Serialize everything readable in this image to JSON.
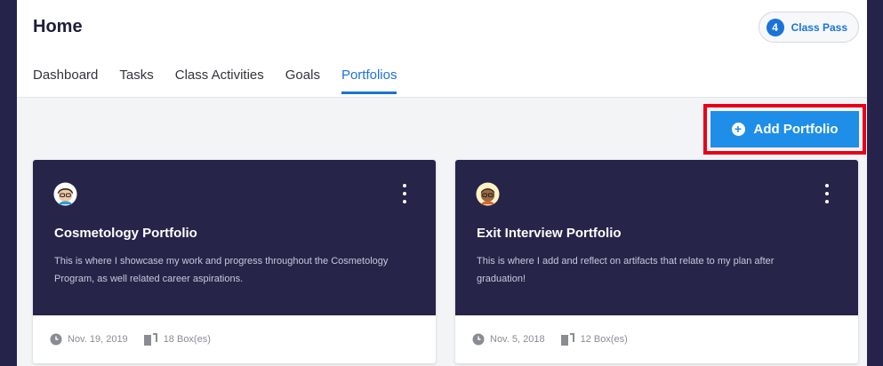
{
  "header": {
    "title": "Home",
    "class_pass": {
      "count": "4",
      "label": "Class Pass"
    }
  },
  "tabs": [
    {
      "label": "Dashboard",
      "active": false
    },
    {
      "label": "Tasks",
      "active": false
    },
    {
      "label": "Class Activities",
      "active": false
    },
    {
      "label": "Goals",
      "active": false
    },
    {
      "label": "Portfolios",
      "active": true
    }
  ],
  "toolbar": {
    "add_label": "Add Portfolio",
    "highlight_color": "#e8001a"
  },
  "portfolios": [
    {
      "title": "Cosmetology Portfolio",
      "description": "This is where I showcase my work and progress throughout the Cosmetology Program, as well related career aspirations.",
      "date": "Nov. 19, 2019",
      "boxes": "18 Box(es)",
      "avatar_icon": "woman-glasses-avatar-icon"
    },
    {
      "title": "Exit Interview Portfolio",
      "description": "This is where I add and reflect on artifacts that relate to my plan after graduation!",
      "date": "Nov. 5, 2018",
      "boxes": "12 Box(es)",
      "avatar_icon": "man-glasses-avatar-icon"
    }
  ],
  "colors": {
    "accent": "#1a73d9",
    "card_dark": "#262449",
    "page_bg": "#25234a"
  }
}
